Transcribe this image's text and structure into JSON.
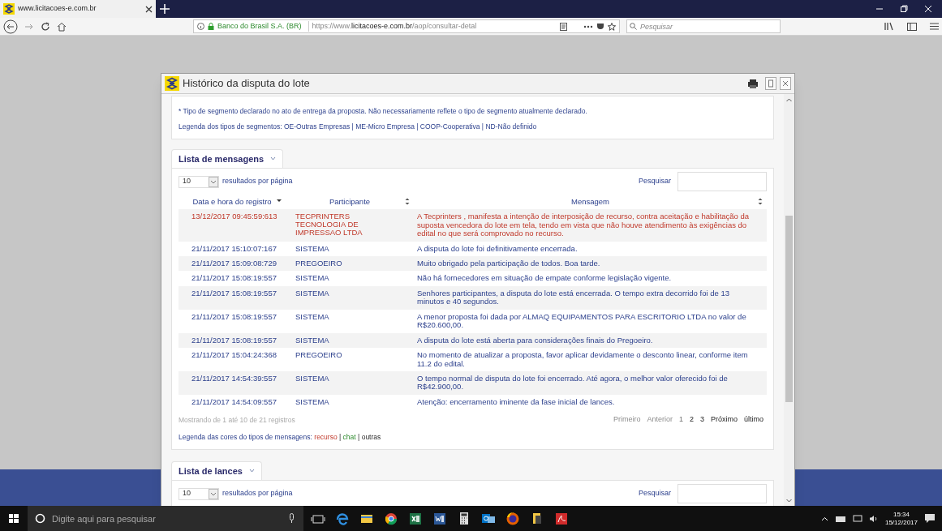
{
  "browser": {
    "tab_title": "www.licitacoes-e.com.br",
    "site_identity": "Banco do Brasil S.A. (BR)",
    "url_prefix": "https://www.",
    "url_domain": "licitacoes-e.com.br",
    "url_path": "/aop/consultar-detal",
    "search_placeholder": "Pesquisar"
  },
  "dialog": {
    "title": "Histórico da disputa do lote",
    "notes": [
      "* Tipo de segmento declarado no ato de entrega da proposta. Não necessariamente reflete o tipo de segmento atualmente declarado.",
      "Legenda dos tipos de segmentos: OE-Outras Empresas | ME-Micro Empresa | COOP-Cooperativa | ND-Não definido"
    ],
    "messages": {
      "title": "Lista de mensagens",
      "page_size": "10",
      "page_size_label": "resultados por página",
      "search_label": "Pesquisar",
      "columns": [
        {
          "label": "Data e hora do registro",
          "sorted": true
        },
        {
          "label": "Participante",
          "sorted": false
        },
        {
          "label": "Mensagem",
          "sorted": false
        }
      ],
      "rows": [
        {
          "kind": "recurso",
          "date": "13/12/2017 09:45:59:613",
          "participant": "TECPRINTERS TECNOLOGIA DE IMPRESSAO LTDA",
          "message": "A Tecprinters , manifesta a intenção de interposição de recurso, contra aceitação e habilitação da suposta vencedora do lote em tela, tendo em vista que não houve atendimento às exigências do edital no que será comprovado no recurso."
        },
        {
          "kind": "outras",
          "date": "21/11/2017 15:10:07:167",
          "participant": "SISTEMA",
          "message": "A disputa do lote foi definitivamente encerrada."
        },
        {
          "kind": "outras",
          "date": "21/11/2017 15:09:08:729",
          "participant": "PREGOEIRO",
          "message": "Muito obrigado pela participação de todos. Boa tarde."
        },
        {
          "kind": "outras",
          "date": "21/11/2017 15:08:19:557",
          "participant": "SISTEMA",
          "message": "Não há fornecedores em situação de empate conforme legislação vigente."
        },
        {
          "kind": "outras",
          "date": "21/11/2017 15:08:19:557",
          "participant": "SISTEMA",
          "message": "Senhores participantes, a disputa do lote está encerrada. O tempo extra decorrido foi de 13 minutos e 40 segundos."
        },
        {
          "kind": "outras",
          "date": "21/11/2017 15:08:19:557",
          "participant": "SISTEMA",
          "message": "A menor proposta foi dada por ALMAQ EQUIPAMENTOS PARA ESCRITORIO LTDA no valor de R$20.600,00."
        },
        {
          "kind": "outras",
          "date": "21/11/2017 15:08:19:557",
          "participant": "SISTEMA",
          "message": "A disputa do lote está aberta para considerações finais do Pregoeiro."
        },
        {
          "kind": "outras",
          "date": "21/11/2017 15:04:24:368",
          "participant": "PREGOEIRO",
          "message": "No momento de atualizar a proposta, favor aplicar devidamente o desconto linear, conforme item 11.2 do edital."
        },
        {
          "kind": "outras",
          "date": "21/11/2017 14:54:39:557",
          "participant": "SISTEMA",
          "message": "O tempo normal de disputa do lote foi encerrado. Até agora, o melhor valor oferecido foi de R$42.900,00."
        },
        {
          "kind": "outras",
          "date": "21/11/2017 14:54:09:557",
          "participant": "SISTEMA",
          "message": "Atenção: encerramento iminente da fase inicial de lances."
        }
      ],
      "footer_info": "Mostrando de 1 até 10 de 21 registros",
      "pagination": [
        {
          "label": "Primeiro",
          "kind": "disabled"
        },
        {
          "label": "Anterior",
          "kind": "disabled"
        },
        {
          "label": "1",
          "kind": "current"
        },
        {
          "label": "2",
          "kind": "link"
        },
        {
          "label": "3",
          "kind": "link"
        },
        {
          "label": "Próximo",
          "kind": "link"
        },
        {
          "label": "último",
          "kind": "link"
        }
      ],
      "legend": [
        {
          "text": "Legenda das cores do tipos de mensagens:",
          "kind": "label"
        },
        {
          "text": "recurso",
          "kind": "recurso"
        },
        {
          "text": "|",
          "kind": "separator"
        },
        {
          "text": "chat",
          "kind": "chat"
        },
        {
          "text": "|",
          "kind": "separator"
        },
        {
          "text": "outras",
          "kind": "plain"
        }
      ]
    },
    "bids": {
      "title": "Lista de lances",
      "page_size": "10",
      "page_size_label": "resultados por página",
      "search_label": "Pesquisar"
    }
  },
  "taskbar": {
    "search_placeholder": "Digite aqui para pesquisar",
    "time": "15:34",
    "date": "15/12/2017"
  }
}
